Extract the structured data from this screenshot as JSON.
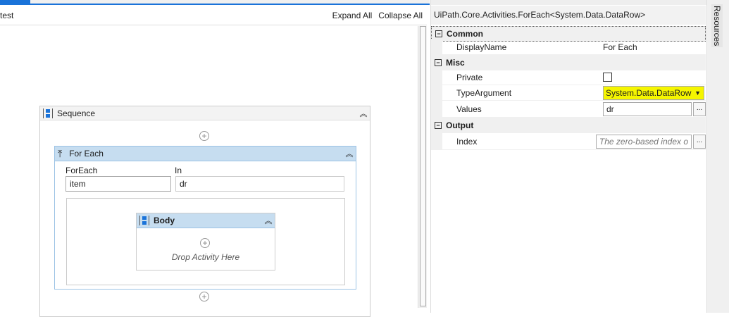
{
  "designer": {
    "breadcrumb": "test",
    "expand_all": "Expand All",
    "collapse_all": "Collapse All"
  },
  "sequence": {
    "title": "Sequence",
    "collapse_icon": "double-chevron-up"
  },
  "foreach": {
    "title": "For Each",
    "foreach_label": "ForEach",
    "foreach_value": "item",
    "in_label": "In",
    "in_value": "dr"
  },
  "body": {
    "title": "Body",
    "drop_hint": "Drop Activity Here"
  },
  "properties": {
    "type_name": "UiPath.Core.Activities.ForEach<System.Data.DataRow>",
    "categories": {
      "common": "Common",
      "misc": "Misc",
      "output": "Output"
    },
    "display_name": {
      "label": "DisplayName",
      "value": "For Each"
    },
    "private": {
      "label": "Private",
      "checked": false
    },
    "type_argument": {
      "label": "TypeArgument",
      "value": "System.Data.DataRow",
      "highlight": "#f5f500"
    },
    "values": {
      "label": "Values",
      "value": "dr",
      "ellipsis": "..."
    },
    "index": {
      "label": "Index",
      "placeholder": "The zero-based index o",
      "ellipsis": "..."
    },
    "collapse_glyph": "−"
  },
  "resources_tab": "Resources",
  "colors": {
    "accent": "#1a73d9",
    "selected_header": "#c6ddf0"
  }
}
